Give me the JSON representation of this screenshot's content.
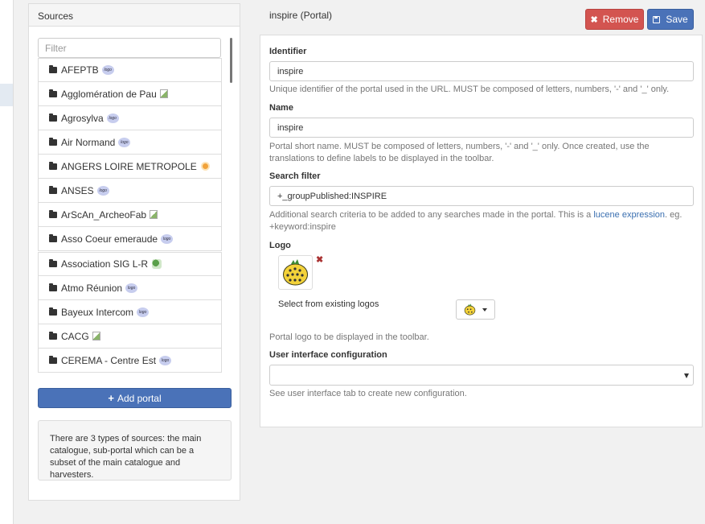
{
  "sources": {
    "title": "Sources",
    "filter_placeholder": "Filter",
    "items": [
      {
        "label": "AFEPTB",
        "logo": "logo-badge-icon"
      },
      {
        "label": "Agglomération de Pau",
        "logo": "broken-image-icon"
      },
      {
        "label": "Agrosylva",
        "logo": "logo-badge-icon"
      },
      {
        "label": "Air Normand",
        "logo": "logo-badge-icon"
      },
      {
        "label": "ANGERS LOIRE METROPOLE",
        "logo": "sun-logo-icon"
      },
      {
        "label": "ANSES",
        "logo": "logo-badge-icon"
      },
      {
        "label": "ArScAn_ArcheoFab",
        "logo": "broken-image-icon"
      },
      {
        "label": "Asso Coeur emeraude",
        "logo": "logo-badge-icon"
      },
      {
        "label": "Association SIG L-R",
        "logo": "leaf-logo-icon"
      },
      {
        "label": "Atmo Réunion",
        "logo": "logo-badge-icon"
      },
      {
        "label": "Bayeux Intercom",
        "logo": "logo-badge-icon"
      },
      {
        "label": "CACG",
        "logo": "broken-image-icon"
      },
      {
        "label": "CEREMA - Centre Est",
        "logo": "logo-badge-icon"
      }
    ],
    "logo_badge_text": "logo",
    "add_button": "Add portal",
    "note": "There are 3 types of sources: the main catalogue, sub-portal which can be a subset of the main catalogue and harvesters."
  },
  "portal": {
    "title": "inspire (Portal)",
    "remove_label": "Remove",
    "save_label": "Save",
    "identifier_label": "Identifier",
    "identifier_value": "inspire",
    "identifier_help": "Unique identifier of the portal used in the URL. MUST be composed of letters, numbers, '-' and '_' only.",
    "name_label": "Name",
    "name_value": "inspire",
    "name_help": "Portal short name. MUST be composed of letters, numbers, '-' and '_' only. Once created, use the translations to define labels to be displayed in the toolbar.",
    "filter_label": "Search filter",
    "filter_value": "+_groupPublished:INSPIRE",
    "filter_help_pre": "Additional search criteria to be added to any searches made in the portal. This is a ",
    "filter_help_link": "lucene expression",
    "filter_help_post": ". eg. +keyword:inspire",
    "logo_label": "Logo",
    "select_logos": "Select from existing logos",
    "logo_help": "Portal logo to be displayed in the toolbar.",
    "ui_label": "User interface configuration",
    "ui_help": "See user interface tab to create new configuration."
  }
}
